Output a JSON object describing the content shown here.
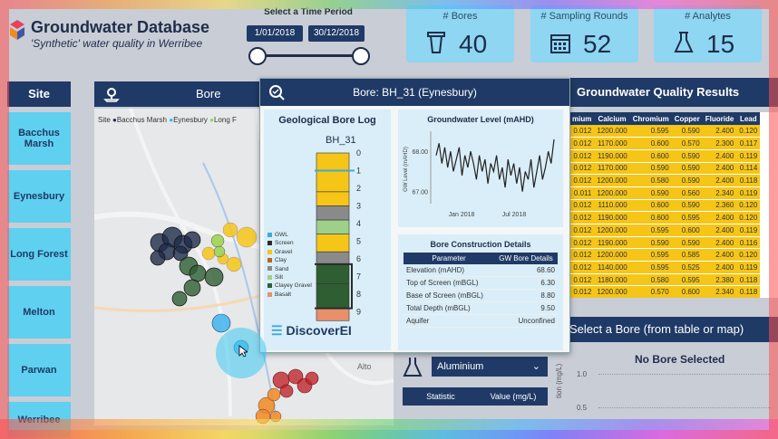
{
  "header": {
    "title": "Groundwater Database",
    "subtitle": "'Synthetic' water quality in Werribee",
    "time_label": "Select a Time Period",
    "start_date": "1/01/2018",
    "end_date": "30/12/2018"
  },
  "kpis": [
    {
      "label": "# Bores",
      "value": "40",
      "icon": "bore-icon"
    },
    {
      "label": "# Sampling Rounds",
      "value": "52",
      "icon": "calendar-icon"
    },
    {
      "label": "# Analytes",
      "value": "15",
      "icon": "flask-icon"
    }
  ],
  "sites": {
    "header": "Site",
    "items": [
      "Bacchus Marsh",
      "Eynesbury",
      "Long Forest",
      "Melton",
      "Parwan",
      "Werribee"
    ]
  },
  "map": {
    "header": "Bore Location",
    "legend_prefix": "Site",
    "legend": [
      "Bacchus Marsh",
      "Eynesbury",
      "Long F"
    ],
    "place_label": "Alto"
  },
  "results": {
    "header": "Groundwater Quality Results",
    "columns": [
      "mium",
      "Calcium",
      "Chromium",
      "Copper",
      "Fluoride",
      "Lead"
    ],
    "rows": [
      [
        "0.012",
        "1200.000",
        "0.595",
        "0.590",
        "2.400",
        "0.120"
      ],
      [
        "0.012",
        "1170.000",
        "0.600",
        "0.570",
        "2.300",
        "0.117"
      ],
      [
        "0.012",
        "1190.000",
        "0.600",
        "0.590",
        "2.400",
        "0.119"
      ],
      [
        "0.012",
        "1170.000",
        "0.590",
        "0.590",
        "2.400",
        "0.114"
      ],
      [
        "0.012",
        "1200.000",
        "0.580",
        "0.590",
        "2.400",
        "0.118"
      ],
      [
        "0.011",
        "1200.000",
        "0.590",
        "0.560",
        "2.340",
        "0.119"
      ],
      [
        "0.012",
        "1110.000",
        "0.600",
        "0.590",
        "2.360",
        "0.120"
      ],
      [
        "0.012",
        "1190.000",
        "0.600",
        "0.595",
        "2.400",
        "0.120"
      ],
      [
        "0.012",
        "1200.000",
        "0.595",
        "0.600",
        "2.400",
        "0.119"
      ],
      [
        "0.012",
        "1190.000",
        "0.590",
        "0.590",
        "2.400",
        "0.116"
      ],
      [
        "0.012",
        "1200.000",
        "0.595",
        "0.585",
        "2.400",
        "0.120"
      ],
      [
        "0.012",
        "1140.000",
        "0.595",
        "0.525",
        "2.400",
        "0.119"
      ],
      [
        "0.012",
        "1180.000",
        "0.580",
        "0.595",
        "2.380",
        "0.118"
      ],
      [
        "0.012",
        "1200.000",
        "0.570",
        "0.600",
        "2.340",
        "0.118"
      ]
    ]
  },
  "select_bore": {
    "header": "Select a Bore (from table or map)",
    "no_bore": "No Bore Selected",
    "y_ticks": [
      "1.0",
      "0.5"
    ],
    "y_label": "tion (mg/L)"
  },
  "analyte": {
    "selected": "Aluminium",
    "stat_col": "Statistic",
    "value_col": "Value (mg/L)"
  },
  "tooltip": {
    "title": "Bore: BH_31 (Eynesbury)",
    "log_title": "Geological Bore Log",
    "bore_id": "BH_31",
    "depth_ticks": [
      "0",
      "1",
      "2",
      "3",
      "4",
      "5",
      "6",
      "7",
      "8",
      "9"
    ],
    "log_legend": [
      "GWL",
      "Screen",
      "Gravel",
      "Clay",
      "Sand",
      "Silt",
      "Clayey Gravel",
      "Basalt"
    ],
    "log_colors": {
      "gravel": "#f5c518",
      "clay": "#b5651d",
      "sand": "#8a8a8a",
      "silt": "#9fd08a",
      "clayey_gravel": "#2e5e32",
      "basalt": "#e8906a",
      "screen": "#2a2a2a",
      "gwl": "#3fa9d9"
    },
    "gwl_title": "Groundwater Level (mAHD)",
    "gwl_ylabel": "GW Level (mAHD)",
    "gwl_yticks": [
      "68.00",
      "67.00"
    ],
    "gwl_xticks": [
      "Jan 2018",
      "Jul 2018"
    ],
    "bcd_title": "Bore Construction Details",
    "bcd_header": [
      "Parameter",
      "GW Bore Details"
    ],
    "bcd_rows": [
      [
        "Elevation (mAHD)",
        "68.60"
      ],
      [
        "Top of Screen (mBGL)",
        "6.30"
      ],
      [
        "Base of Screen (mBGL)",
        "8.80"
      ],
      [
        "Total Depth (mBGL)",
        "9.50"
      ],
      [
        "Aquifer",
        "Unconfined"
      ]
    ],
    "brand": "DiscoverEI"
  },
  "chart_data": {
    "type": "line",
    "title": "Groundwater Level (mAHD)",
    "xlabel": "",
    "ylabel": "GW Level (mAHD)",
    "x_ticks": [
      "Jan 2018",
      "Jul 2018"
    ],
    "ylim": [
      66.7,
      68.5
    ],
    "series": [
      {
        "values": [
          67.9,
          68.2,
          67.7,
          68.1,
          67.6,
          68.0,
          67.5,
          67.8,
          68.1,
          67.4,
          67.9,
          67.6,
          68.0,
          67.7,
          67.3,
          67.9,
          67.5,
          67.8,
          67.2,
          67.7,
          67.5,
          67.9,
          67.3,
          67.6,
          67.1,
          67.8,
          67.4,
          67.7,
          67.2,
          67.6,
          67.0,
          67.5,
          67.3,
          67.8,
          67.1,
          67.5,
          67.9,
          67.3,
          67.6,
          68.0,
          67.7,
          68.3
        ]
      }
    ]
  }
}
